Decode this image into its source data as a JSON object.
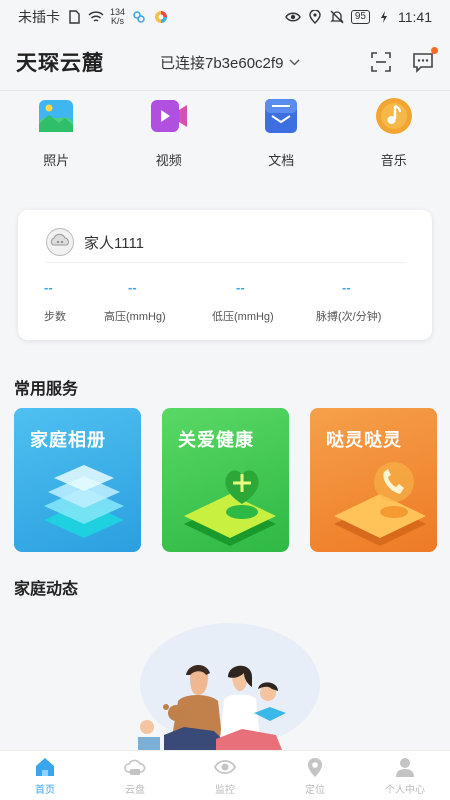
{
  "status_bar": {
    "carrier": "未插卡",
    "net_speed_value": "134",
    "net_speed_unit": "K/s",
    "battery": "95",
    "time": "11:41"
  },
  "header": {
    "title": "天琛云麓",
    "connection": "已连接7b3e60c2f9"
  },
  "quick_menu": [
    {
      "label": "照片",
      "icon": "photo-icon",
      "color": "#3fb6f0"
    },
    {
      "label": "视频",
      "icon": "video-icon",
      "color": "#b04fe0"
    },
    {
      "label": "文档",
      "icon": "document-icon",
      "color": "#3d6fe0"
    },
    {
      "label": "音乐",
      "icon": "music-icon",
      "color": "#f2a531"
    }
  ],
  "health": {
    "name": "家人1111",
    "metrics": [
      {
        "value": "--",
        "label": "步数"
      },
      {
        "value": "--",
        "label": "高压(mmHg)"
      },
      {
        "value": "--",
        "label": "低压(mmHg)"
      },
      {
        "value": "--",
        "label": "脉搏(次/分钟)"
      }
    ]
  },
  "services": {
    "title": "常用服务",
    "cards": [
      {
        "label": "家庭相册",
        "color": "#3ab0e8"
      },
      {
        "label": "关爱健康",
        "color": "#3ec84e"
      },
      {
        "label": "哒灵哒灵",
        "color": "#f28a2e"
      }
    ]
  },
  "family": {
    "title": "家庭动态"
  },
  "bottom_nav": [
    {
      "label": "首页",
      "active": true
    },
    {
      "label": "云盘",
      "active": false
    },
    {
      "label": "监控",
      "active": false
    },
    {
      "label": "定位",
      "active": false
    },
    {
      "label": "个人中心",
      "active": false
    }
  ],
  "colors": {
    "accent": "#3aa5ee",
    "notification_dot": "#ff6a1a"
  }
}
